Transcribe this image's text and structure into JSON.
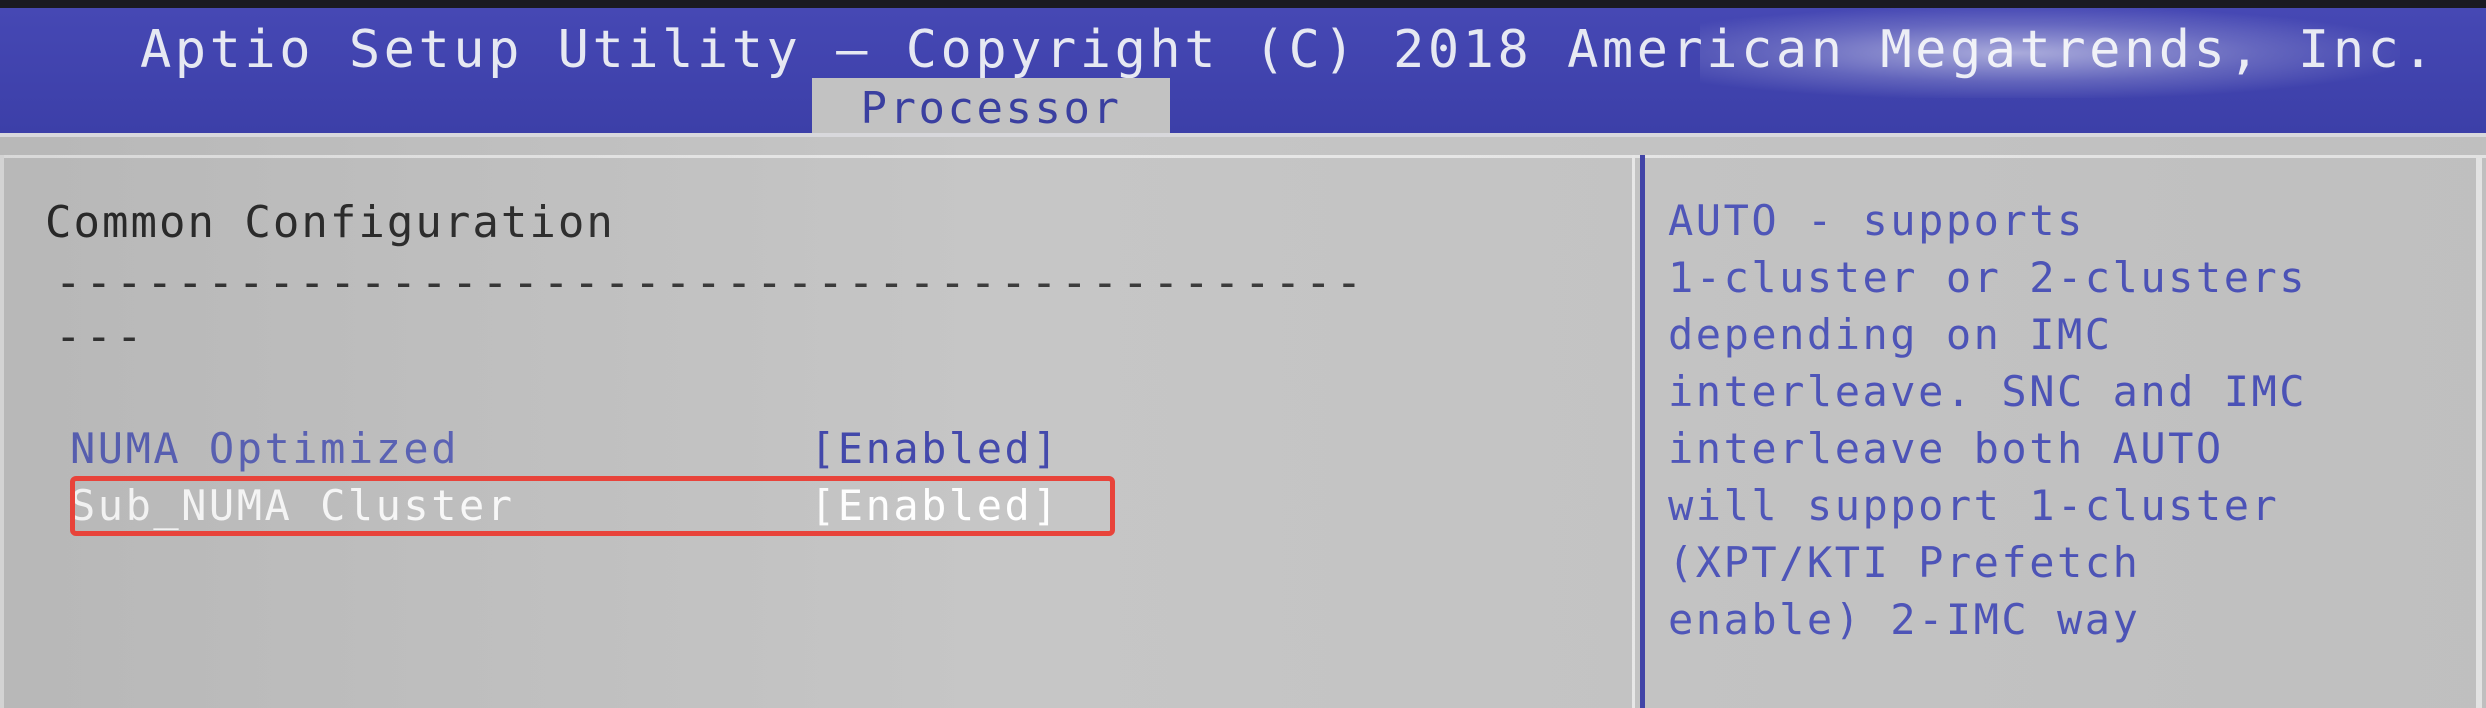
{
  "title_bar": {
    "title": "Aptio Setup Utility – Copyright (C) 2018 American Megatrends, Inc."
  },
  "tabs": [
    {
      "label": "Processor",
      "active": true
    }
  ],
  "main": {
    "section_title": "Common Configuration",
    "dash_line_1": "-------------------------------------------",
    "dash_line_2": "---",
    "options": [
      {
        "label": "NUMA Optimized",
        "value": "[Enabled]",
        "selected": false
      },
      {
        "label": "Sub_NUMA Cluster",
        "value": "[Enabled]",
        "selected": true
      }
    ]
  },
  "help": {
    "lines": [
      {
        "prefix": "AUTO",
        "rest": " - supports"
      },
      {
        "text": "1-cluster or 2-clusters"
      },
      {
        "text": "depending on IMC"
      },
      {
        "text": "interleave. SNC and IMC"
      },
      {
        "text": "interleave both AUTO"
      },
      {
        "text": "will support 1-cluster"
      },
      {
        "text": "(XPT/KTI Prefetch"
      },
      {
        "text": "enable) 2-IMC way"
      }
    ]
  },
  "colors": {
    "title_bg": "#4648b4",
    "content_bg": "#c3c3c3",
    "option_label": "#5a62b8",
    "option_value": "#3a40a8",
    "selected_text": "#ffffff",
    "help_text": "#4b52b8",
    "highlight_border": "#e8433a"
  }
}
